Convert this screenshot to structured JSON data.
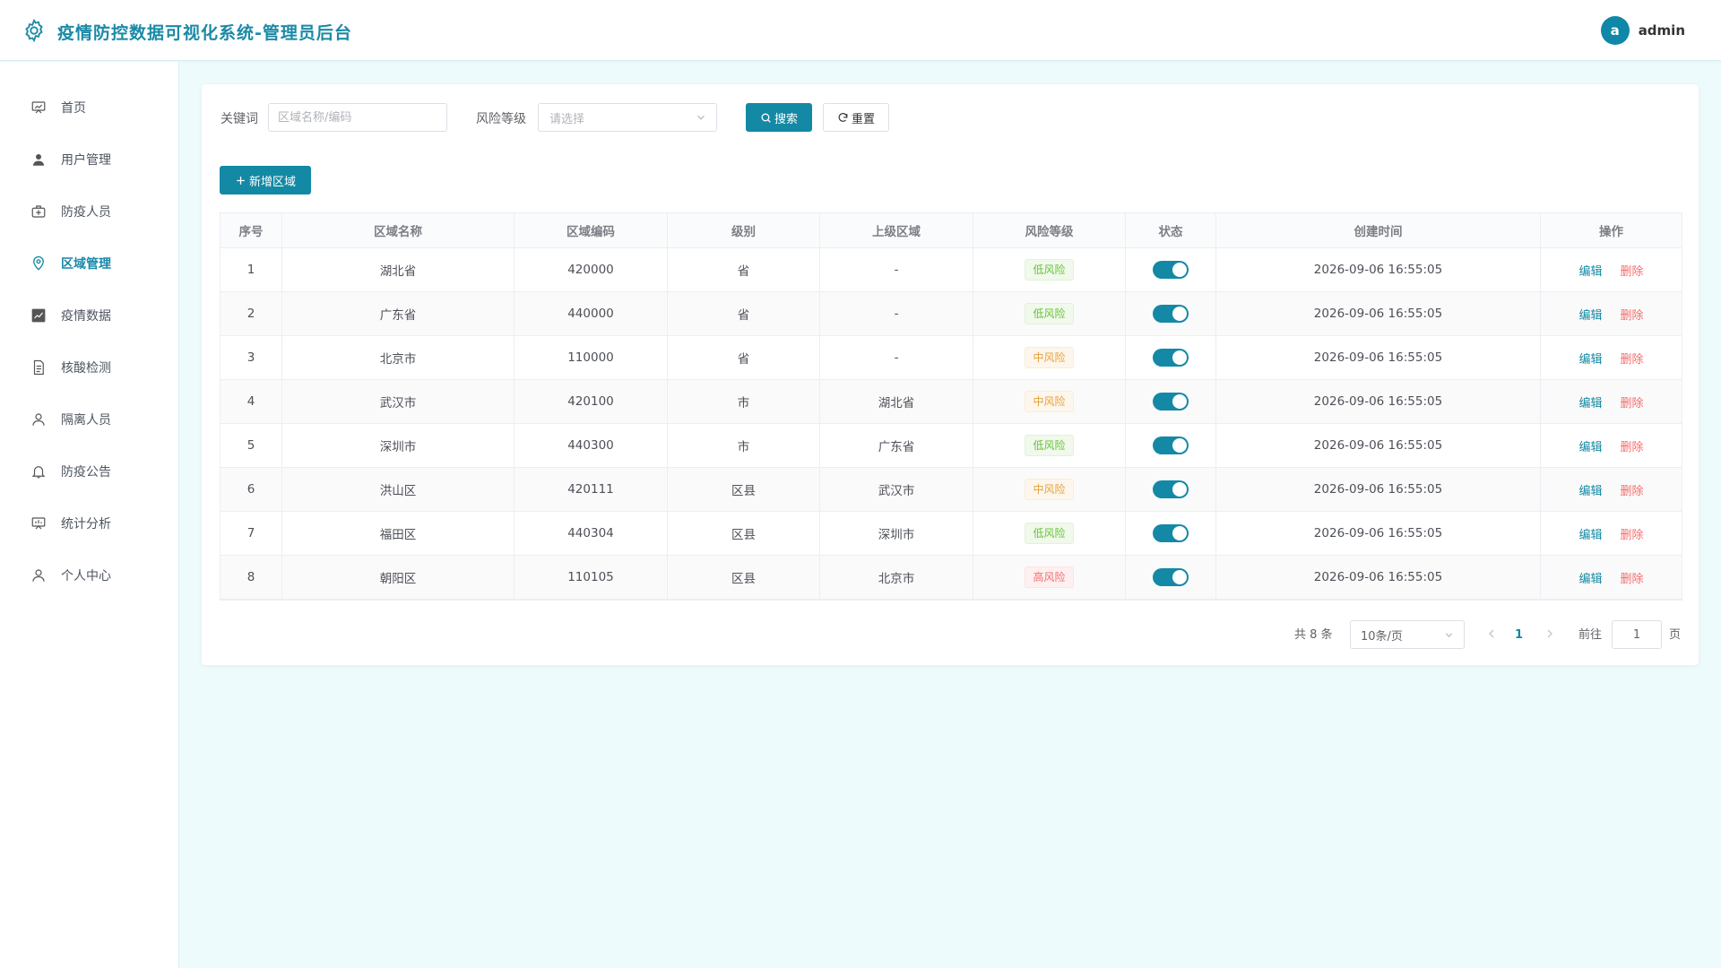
{
  "header": {
    "title": "疫情防控数据可视化系统-管理员后台",
    "avatar_letter": "a",
    "username": "admin"
  },
  "sidebar": {
    "items": [
      {
        "label": "首页",
        "icon": "home-chart-icon"
      },
      {
        "label": "用户管理",
        "icon": "user-icon"
      },
      {
        "label": "防疫人员",
        "icon": "medical-kit-icon"
      },
      {
        "label": "区域管理",
        "icon": "location-pin-icon",
        "active": true
      },
      {
        "label": "疫情数据",
        "icon": "data-chart-icon"
      },
      {
        "label": "核酸检测",
        "icon": "document-icon"
      },
      {
        "label": "隔离人员",
        "icon": "person-icon"
      },
      {
        "label": "防疫公告",
        "icon": "bell-icon"
      },
      {
        "label": "统计分析",
        "icon": "presentation-icon"
      },
      {
        "label": "个人中心",
        "icon": "profile-icon"
      }
    ]
  },
  "filters": {
    "keyword_label": "关键词",
    "keyword_placeholder": "区域名称/编码",
    "keyword_value": "",
    "risk_label": "风险等级",
    "risk_placeholder": "请选择",
    "search_label": "搜索",
    "reset_label": "重置"
  },
  "toolbar": {
    "add_label": "新增区域"
  },
  "table": {
    "headers": {
      "idx": "序号",
      "name": "区域名称",
      "code": "区域编码",
      "level": "级别",
      "parent": "上级区域",
      "risk": "风险等级",
      "status": "状态",
      "created": "创建时间",
      "ops": "操作"
    },
    "edit_label": "编辑",
    "delete_label": "删除",
    "rows": [
      {
        "idx": "1",
        "name": "湖北省",
        "code": "420000",
        "level": "省",
        "parent": "-",
        "risk": "低风险",
        "risk_type": "low",
        "status": true,
        "created": "2026-09-06 16:55:05"
      },
      {
        "idx": "2",
        "name": "广东省",
        "code": "440000",
        "level": "省",
        "parent": "-",
        "risk": "低风险",
        "risk_type": "low",
        "status": true,
        "created": "2026-09-06 16:55:05"
      },
      {
        "idx": "3",
        "name": "北京市",
        "code": "110000",
        "level": "省",
        "parent": "-",
        "risk": "中风险",
        "risk_type": "mid",
        "status": true,
        "created": "2026-09-06 16:55:05"
      },
      {
        "idx": "4",
        "name": "武汉市",
        "code": "420100",
        "level": "市",
        "parent": "湖北省",
        "risk": "中风险",
        "risk_type": "mid",
        "status": true,
        "created": "2026-09-06 16:55:05"
      },
      {
        "idx": "5",
        "name": "深圳市",
        "code": "440300",
        "level": "市",
        "parent": "广东省",
        "risk": "低风险",
        "risk_type": "low",
        "status": true,
        "created": "2026-09-06 16:55:05"
      },
      {
        "idx": "6",
        "name": "洪山区",
        "code": "420111",
        "level": "区县",
        "parent": "武汉市",
        "risk": "中风险",
        "risk_type": "mid",
        "status": true,
        "created": "2026-09-06 16:55:05"
      },
      {
        "idx": "7",
        "name": "福田区",
        "code": "440304",
        "level": "区县",
        "parent": "深圳市",
        "risk": "低风险",
        "risk_type": "low",
        "status": true,
        "created": "2026-09-06 16:55:05"
      },
      {
        "idx": "8",
        "name": "朝阳区",
        "code": "110105",
        "level": "区县",
        "parent": "北京市",
        "risk": "高风险",
        "risk_type": "high",
        "status": true,
        "created": "2026-09-06 16:55:05"
      }
    ]
  },
  "pagination": {
    "total_text": "共 8 条",
    "page_size": "10条/页",
    "current_page": "1",
    "goto_label": "前往",
    "goto_value": "1",
    "page_unit": "页"
  },
  "colors": {
    "primary": "#1389a5",
    "danger": "#f56c6c",
    "success": "#67c23a",
    "warning": "#e6a23c"
  }
}
